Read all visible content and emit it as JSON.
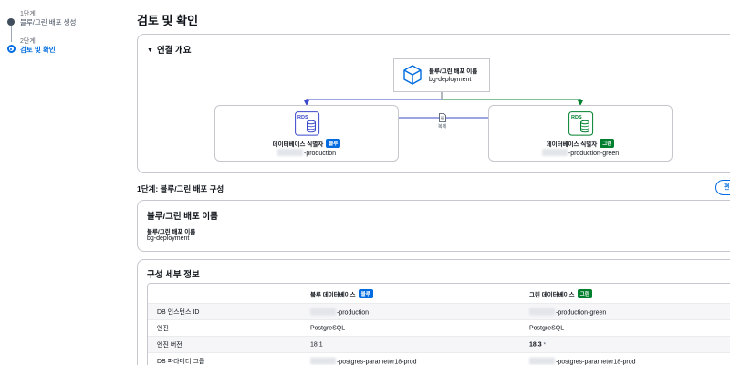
{
  "steps": [
    {
      "num": "1단계",
      "name": "블루/그린 배포 생성"
    },
    {
      "num": "2단계",
      "name": "검토 및 확인"
    }
  ],
  "page_title": "검토 및 확인",
  "overview": {
    "title": "연결 개요",
    "deployment_label": "블루/그린 배포 이름",
    "deployment_value": "bg-deployment",
    "rds_icon_text": "RDS",
    "copy_label": "복제",
    "blue_db": {
      "label": "데이터베이스 식별자",
      "badge": "블루",
      "value": "-production"
    },
    "green_db": {
      "label": "데이터베이스 식별자",
      "badge": "그린",
      "value": "-production-green"
    },
    "colors": {
      "blue": "#006ce0",
      "green": "#00802f"
    }
  },
  "step1": {
    "heading": "1단계: 블루/그린 배포 구성",
    "edit_label": "편집"
  },
  "name_card": {
    "title": "블루/그린 배포 이름",
    "label": "블루/그린 배포 이름",
    "value": "bg-deployment"
  },
  "config": {
    "title": "구성 세부 정보",
    "headers": {
      "blue": "블루 데이터베이스",
      "blue_badge": "블루",
      "green": "그린 데이터베이스",
      "green_badge": "그린"
    },
    "rows": [
      {
        "label": "DB 인스턴스 ID",
        "blue": "-production",
        "green": "-production-green"
      },
      {
        "label": "엔진",
        "blue": "PostgreSQL",
        "green": "PostgreSQL"
      },
      {
        "label": "엔진 버전",
        "blue": "18.1",
        "green": "18.3",
        "green_mark": "*"
      },
      {
        "label": "DB 파라미터 그룹",
        "blue": "-postgres-parameter18-prod",
        "green": "-postgres-parameter18-prod"
      }
    ]
  }
}
